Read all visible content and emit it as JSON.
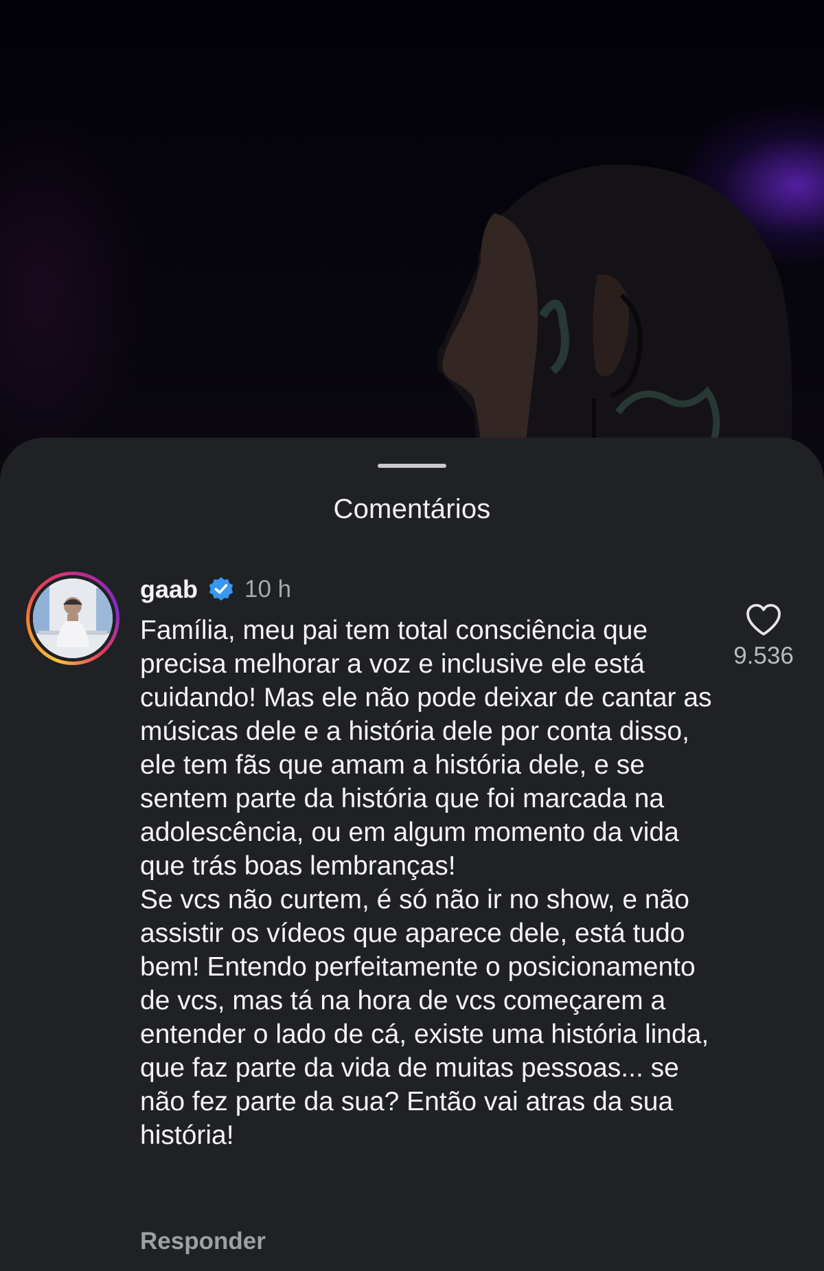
{
  "sheet": {
    "title": "Comentários"
  },
  "comment": {
    "username": "gaab",
    "verified_icon": "verified-badge-icon",
    "timestamp": "10 h",
    "paragraphs": [
      "Família, meu pai tem total consciência que precisa melhorar a voz e inclusive ele está cuidando! Mas ele não pode deixar de cantar as músicas dele e a história dele por conta disso, ele tem fãs que amam a história dele, e se sentem parte da história que foi marcada na adolescência, ou em algum momento da vida que trás boas lembranças!",
      "Se vcs não curtem, é só não ir no show, e não assistir os vídeos que aparece dele, está tudo bem! Entendo perfeitamente o posicionamento de vcs, mas tá na hora de vcs começarem a entender o lado de cá, existe uma história linda, que faz parte da vida de muitas pessoas... se não fez parte da sua? Então vai atras da sua história!"
    ],
    "reply_label": "Responder",
    "like_icon": "heart-outline-icon",
    "like_count": "9.536"
  },
  "colors": {
    "sheet_background": "#1f2125",
    "primary_text": "#f5f5f7",
    "secondary_text": "#a7a9ae",
    "verified_blue": "#3897f0",
    "story_ring": [
      "#f9c23c",
      "#e43a5e",
      "#7b2fc9"
    ]
  }
}
